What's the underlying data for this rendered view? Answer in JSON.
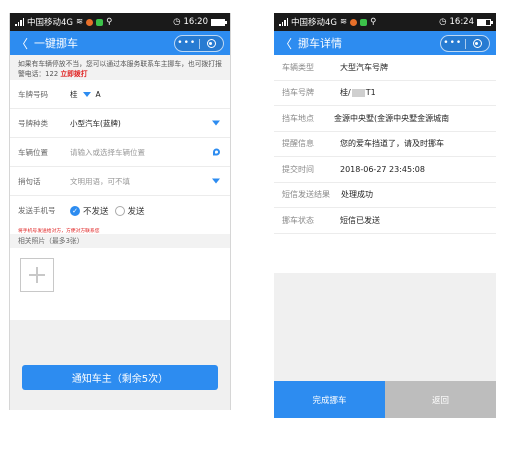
{
  "left": {
    "status": {
      "carrier": "中国移动4G",
      "time": "16:20",
      "battery_level": 1.0
    },
    "nav": {
      "back": "〈",
      "title": "一键挪车",
      "more": "•••"
    },
    "notice": {
      "text": "如果有车辆停放不当，您可以通过本服务联系车主挪车，也可拨打报警电话：122 ",
      "call": "立即拨打"
    },
    "form": {
      "plate": {
        "label": "车牌号码",
        "province": "桂",
        "letter": "A"
      },
      "type": {
        "label": "号牌种类",
        "value": "小型汽车(蓝牌)"
      },
      "location": {
        "label": "车辆位置",
        "placeholder": "请输入或选择车辆位置"
      },
      "message": {
        "label": "捎句话",
        "placeholder": "文明用语，可不填"
      },
      "sms": {
        "label": "发送手机号",
        "opt_no": "不发送",
        "opt_yes": "发送",
        "selected": "不发送"
      }
    },
    "warning": "将手机号发送给对方，方便对方联系您",
    "photos": {
      "label": "相关照片（最多3张）"
    },
    "notify_button": "通知车主（剩余5次）"
  },
  "right": {
    "status": {
      "carrier": "中国移动4G",
      "time": "16:24",
      "battery_level": 0.7
    },
    "nav": {
      "back": "〈",
      "title": "挪车详情",
      "more": "•••"
    },
    "details": [
      {
        "label": "车辆类型",
        "value": "大型汽车号牌"
      },
      {
        "label": "挡车号牌",
        "value_prefix": "桂/",
        "value_suffix": "T1"
      },
      {
        "label": "挡车地点",
        "value": "金源中央墅(金源中央墅金源城南"
      },
      {
        "label": "提醒信息",
        "value": "您的爱车挡道了，请及时挪车"
      },
      {
        "label": "提交时间",
        "value": "2018-06-27 23:45:08"
      },
      {
        "label": "短信发送结果",
        "value": "处理成功"
      },
      {
        "label": "挪车状态",
        "value": "短信已发送"
      }
    ],
    "buttons": {
      "done": "完成挪车",
      "back": "返回"
    }
  },
  "colors": {
    "accent": "#2d8cf0",
    "danger": "#e02020",
    "disabled": "#bdbdbd"
  }
}
